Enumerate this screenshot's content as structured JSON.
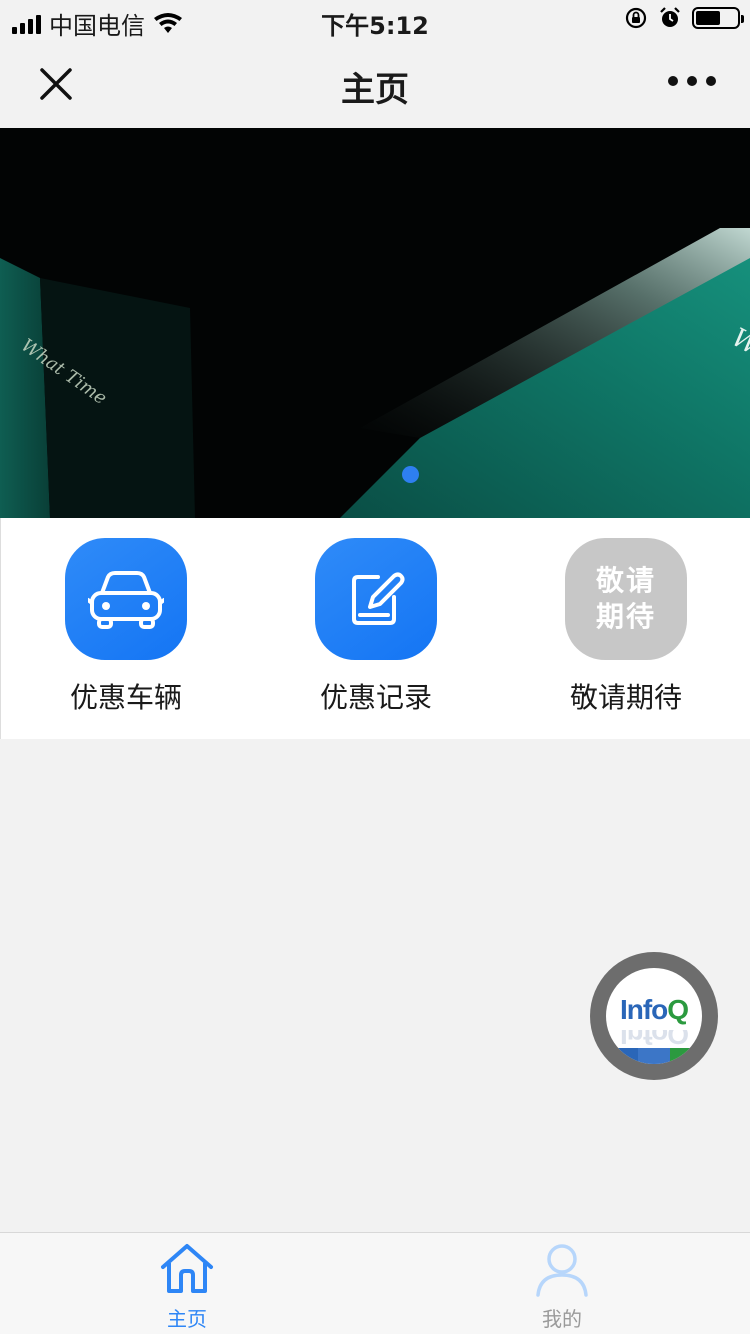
{
  "status_bar": {
    "carrier": "中国电信",
    "time": "下午5:12",
    "battery_level": 0.6
  },
  "nav": {
    "title": "主页",
    "close_icon": "close-icon",
    "more_icon": "more-dots-icon"
  },
  "banner": {
    "active_index": 0,
    "page_count": 1
  },
  "shortcuts": [
    {
      "label": "优惠车辆",
      "icon": "car-icon",
      "color": "#1f80f6"
    },
    {
      "label": "优惠记录",
      "icon": "edit-note-icon",
      "color": "#1f80f6"
    },
    {
      "label": "敬请期待",
      "tile_text": [
        "敬请",
        "期待"
      ],
      "color": "#c7c7c7"
    }
  ],
  "floating_badge": {
    "text_info": "Info",
    "text_q": "Q",
    "colors": {
      "info": "#2a66b8",
      "q": "#2b9a3f"
    }
  },
  "tab_bar": {
    "tabs": [
      {
        "label": "主页",
        "icon": "home-icon",
        "active": true
      },
      {
        "label": "我的",
        "icon": "user-icon",
        "active": false
      }
    ],
    "active_color": "#2e86f6",
    "inactive_color": "#9a9a9a"
  }
}
